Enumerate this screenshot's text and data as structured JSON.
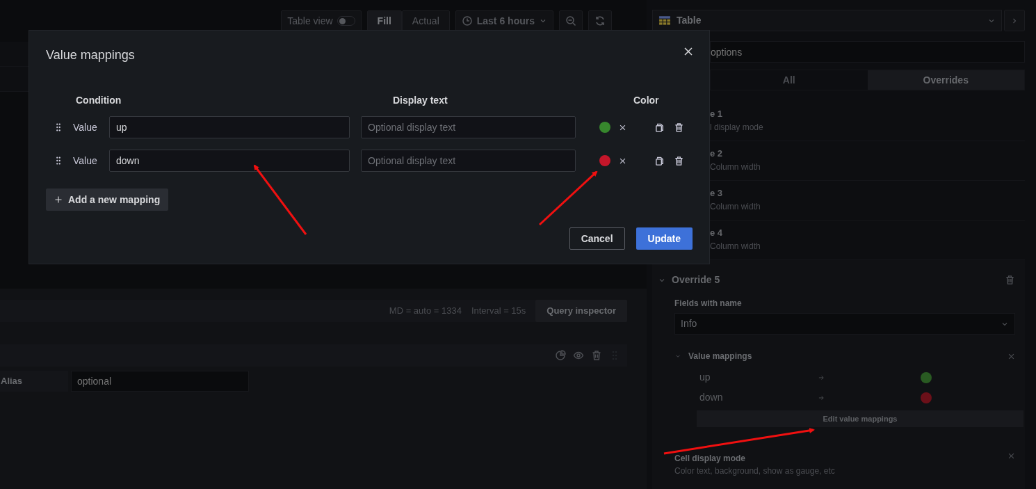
{
  "toolbar": {
    "table_view": {
      "label": "Table view",
      "on": false
    },
    "fill_modes": [
      {
        "label": "Fill",
        "selected": true
      },
      {
        "label": "Actual",
        "selected": false
      }
    ],
    "time_range": "Last 6 hours"
  },
  "visualization": {
    "name": "Table"
  },
  "options_search": {
    "placeholder": "options"
  },
  "option_tabs": [
    {
      "label": "All",
      "selected": false
    },
    {
      "label": "Overrides",
      "selected": true
    }
  ],
  "overrides": [
    {
      "title": "e 1",
      "subtitle": "l display mode"
    },
    {
      "title": "e 2",
      "subtitle": "Column width"
    },
    {
      "title": "e 3",
      "subtitle": "Column width"
    },
    {
      "title": "e 4",
      "subtitle": "Column width"
    }
  ],
  "override_5": {
    "title": "Override 5",
    "expanded": true,
    "matcher_label": "Fields with name",
    "matcher_value": "Info",
    "properties": [
      {
        "kind": "mappings",
        "title": "Value mappings",
        "expanded": true,
        "mappings": [
          {
            "value": "up",
            "color": "#295a22"
          },
          {
            "value": "down",
            "color": "#6b1019"
          }
        ],
        "edit_button": "Edit value mappings"
      },
      {
        "kind": "text",
        "title": "Cell display mode",
        "description": "Color text, background, show as gauge, etc"
      }
    ]
  },
  "query": {
    "md": "MD = auto = 1334",
    "interval": "Interval = 15s",
    "inspector_button": "Query inspector",
    "alias_label": "Alias",
    "alias_placeholder": "optional"
  },
  "modal": {
    "title": "Value mappings",
    "columns": [
      "Condition",
      "Display text",
      "Color"
    ],
    "rows": [
      {
        "type_label": "Value",
        "value": "up",
        "display_placeholder": "Optional display text",
        "color": "#37872d"
      },
      {
        "type_label": "Value",
        "value": "down",
        "display_placeholder": "Optional display text",
        "color": "#c4162a"
      }
    ],
    "add_button": "Add a new mapping",
    "cancel_button": "Cancel",
    "update_button": "Update"
  }
}
